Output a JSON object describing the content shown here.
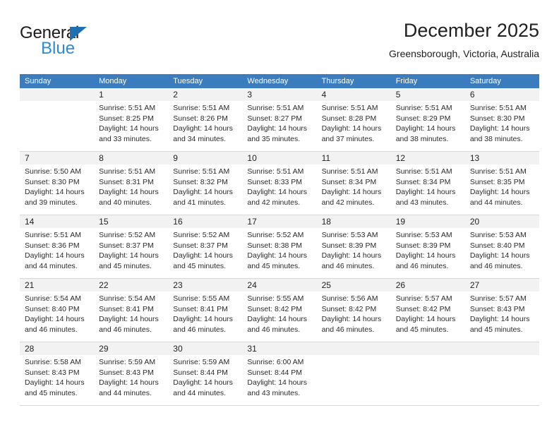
{
  "brand": {
    "name_top": "General",
    "name_bottom": "Blue",
    "accent_color": "#2e8ad4",
    "triangle_color": "#1f6fb5"
  },
  "header": {
    "title": "December 2025",
    "subtitle": "Greensborough, Victoria, Australia"
  },
  "calendar": {
    "header_bg": "#3a7cbe",
    "weekdays": [
      "Sunday",
      "Monday",
      "Tuesday",
      "Wednesday",
      "Thursday",
      "Friday",
      "Saturday"
    ],
    "weeks": [
      [
        {
          "day": "",
          "sunrise": "",
          "sunset": "",
          "daylight1": "",
          "daylight2": "",
          "empty": true
        },
        {
          "day": "1",
          "sunrise": "Sunrise: 5:51 AM",
          "sunset": "Sunset: 8:25 PM",
          "daylight1": "Daylight: 14 hours",
          "daylight2": "and 33 minutes."
        },
        {
          "day": "2",
          "sunrise": "Sunrise: 5:51 AM",
          "sunset": "Sunset: 8:26 PM",
          "daylight1": "Daylight: 14 hours",
          "daylight2": "and 34 minutes."
        },
        {
          "day": "3",
          "sunrise": "Sunrise: 5:51 AM",
          "sunset": "Sunset: 8:27 PM",
          "daylight1": "Daylight: 14 hours",
          "daylight2": "and 35 minutes."
        },
        {
          "day": "4",
          "sunrise": "Sunrise: 5:51 AM",
          "sunset": "Sunset: 8:28 PM",
          "daylight1": "Daylight: 14 hours",
          "daylight2": "and 37 minutes."
        },
        {
          "day": "5",
          "sunrise": "Sunrise: 5:51 AM",
          "sunset": "Sunset: 8:29 PM",
          "daylight1": "Daylight: 14 hours",
          "daylight2": "and 38 minutes."
        },
        {
          "day": "6",
          "sunrise": "Sunrise: 5:51 AM",
          "sunset": "Sunset: 8:30 PM",
          "daylight1": "Daylight: 14 hours",
          "daylight2": "and 38 minutes."
        }
      ],
      [
        {
          "day": "7",
          "sunrise": "Sunrise: 5:50 AM",
          "sunset": "Sunset: 8:30 PM",
          "daylight1": "Daylight: 14 hours",
          "daylight2": "and 39 minutes."
        },
        {
          "day": "8",
          "sunrise": "Sunrise: 5:51 AM",
          "sunset": "Sunset: 8:31 PM",
          "daylight1": "Daylight: 14 hours",
          "daylight2": "and 40 minutes."
        },
        {
          "day": "9",
          "sunrise": "Sunrise: 5:51 AM",
          "sunset": "Sunset: 8:32 PM",
          "daylight1": "Daylight: 14 hours",
          "daylight2": "and 41 minutes."
        },
        {
          "day": "10",
          "sunrise": "Sunrise: 5:51 AM",
          "sunset": "Sunset: 8:33 PM",
          "daylight1": "Daylight: 14 hours",
          "daylight2": "and 42 minutes."
        },
        {
          "day": "11",
          "sunrise": "Sunrise: 5:51 AM",
          "sunset": "Sunset: 8:34 PM",
          "daylight1": "Daylight: 14 hours",
          "daylight2": "and 42 minutes."
        },
        {
          "day": "12",
          "sunrise": "Sunrise: 5:51 AM",
          "sunset": "Sunset: 8:34 PM",
          "daylight1": "Daylight: 14 hours",
          "daylight2": "and 43 minutes."
        },
        {
          "day": "13",
          "sunrise": "Sunrise: 5:51 AM",
          "sunset": "Sunset: 8:35 PM",
          "daylight1": "Daylight: 14 hours",
          "daylight2": "and 44 minutes."
        }
      ],
      [
        {
          "day": "14",
          "sunrise": "Sunrise: 5:51 AM",
          "sunset": "Sunset: 8:36 PM",
          "daylight1": "Daylight: 14 hours",
          "daylight2": "and 44 minutes."
        },
        {
          "day": "15",
          "sunrise": "Sunrise: 5:52 AM",
          "sunset": "Sunset: 8:37 PM",
          "daylight1": "Daylight: 14 hours",
          "daylight2": "and 45 minutes."
        },
        {
          "day": "16",
          "sunrise": "Sunrise: 5:52 AM",
          "sunset": "Sunset: 8:37 PM",
          "daylight1": "Daylight: 14 hours",
          "daylight2": "and 45 minutes."
        },
        {
          "day": "17",
          "sunrise": "Sunrise: 5:52 AM",
          "sunset": "Sunset: 8:38 PM",
          "daylight1": "Daylight: 14 hours",
          "daylight2": "and 45 minutes."
        },
        {
          "day": "18",
          "sunrise": "Sunrise: 5:53 AM",
          "sunset": "Sunset: 8:39 PM",
          "daylight1": "Daylight: 14 hours",
          "daylight2": "and 46 minutes."
        },
        {
          "day": "19",
          "sunrise": "Sunrise: 5:53 AM",
          "sunset": "Sunset: 8:39 PM",
          "daylight1": "Daylight: 14 hours",
          "daylight2": "and 46 minutes."
        },
        {
          "day": "20",
          "sunrise": "Sunrise: 5:53 AM",
          "sunset": "Sunset: 8:40 PM",
          "daylight1": "Daylight: 14 hours",
          "daylight2": "and 46 minutes."
        }
      ],
      [
        {
          "day": "21",
          "sunrise": "Sunrise: 5:54 AM",
          "sunset": "Sunset: 8:40 PM",
          "daylight1": "Daylight: 14 hours",
          "daylight2": "and 46 minutes."
        },
        {
          "day": "22",
          "sunrise": "Sunrise: 5:54 AM",
          "sunset": "Sunset: 8:41 PM",
          "daylight1": "Daylight: 14 hours",
          "daylight2": "and 46 minutes."
        },
        {
          "day": "23",
          "sunrise": "Sunrise: 5:55 AM",
          "sunset": "Sunset: 8:41 PM",
          "daylight1": "Daylight: 14 hours",
          "daylight2": "and 46 minutes."
        },
        {
          "day": "24",
          "sunrise": "Sunrise: 5:55 AM",
          "sunset": "Sunset: 8:42 PM",
          "daylight1": "Daylight: 14 hours",
          "daylight2": "and 46 minutes."
        },
        {
          "day": "25",
          "sunrise": "Sunrise: 5:56 AM",
          "sunset": "Sunset: 8:42 PM",
          "daylight1": "Daylight: 14 hours",
          "daylight2": "and 46 minutes."
        },
        {
          "day": "26",
          "sunrise": "Sunrise: 5:57 AM",
          "sunset": "Sunset: 8:42 PM",
          "daylight1": "Daylight: 14 hours",
          "daylight2": "and 45 minutes."
        },
        {
          "day": "27",
          "sunrise": "Sunrise: 5:57 AM",
          "sunset": "Sunset: 8:43 PM",
          "daylight1": "Daylight: 14 hours",
          "daylight2": "and 45 minutes."
        }
      ],
      [
        {
          "day": "28",
          "sunrise": "Sunrise: 5:58 AM",
          "sunset": "Sunset: 8:43 PM",
          "daylight1": "Daylight: 14 hours",
          "daylight2": "and 45 minutes."
        },
        {
          "day": "29",
          "sunrise": "Sunrise: 5:59 AM",
          "sunset": "Sunset: 8:43 PM",
          "daylight1": "Daylight: 14 hours",
          "daylight2": "and 44 minutes."
        },
        {
          "day": "30",
          "sunrise": "Sunrise: 5:59 AM",
          "sunset": "Sunset: 8:44 PM",
          "daylight1": "Daylight: 14 hours",
          "daylight2": "and 44 minutes."
        },
        {
          "day": "31",
          "sunrise": "Sunrise: 6:00 AM",
          "sunset": "Sunset: 8:44 PM",
          "daylight1": "Daylight: 14 hours",
          "daylight2": "and 43 minutes."
        },
        {
          "day": "",
          "sunrise": "",
          "sunset": "",
          "daylight1": "",
          "daylight2": "",
          "empty": true
        },
        {
          "day": "",
          "sunrise": "",
          "sunset": "",
          "daylight1": "",
          "daylight2": "",
          "empty": true
        },
        {
          "day": "",
          "sunrise": "",
          "sunset": "",
          "daylight1": "",
          "daylight2": "",
          "empty": true
        }
      ]
    ]
  }
}
